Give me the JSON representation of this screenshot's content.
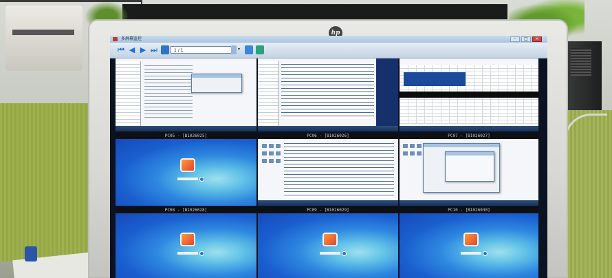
{
  "viewer": {
    "title": "多屏幕监控",
    "page_field": "1 / 1",
    "window_buttons": {
      "minimize": "–",
      "maximize": "□",
      "close": "×"
    }
  },
  "monitor": {
    "brand": "hp"
  },
  "icons": {
    "first": "first-page-icon",
    "prev": "prev-page-icon",
    "next": "next-page-icon",
    "last": "last-page-icon",
    "home": "home-icon",
    "view": "view-icon",
    "network": "network-icon",
    "tools": "tools-icon"
  },
  "cells": [
    {
      "label": "",
      "kind": "desktop-doc"
    },
    {
      "label": "",
      "kind": "desktop-code"
    },
    {
      "label": "",
      "kind": "desktop-sheet"
    },
    {
      "label": "PC05 - [B1026025]",
      "kind": "login"
    },
    {
      "label": "PC06 - [B1026026]",
      "kind": "desktop-dev"
    },
    {
      "label": "PC07 - [B1026027]",
      "kind": "desktop-dialog"
    },
    {
      "label": "PC08 - [B1026028]",
      "kind": "login"
    },
    {
      "label": "PC09 - [B1026029]",
      "kind": "login"
    },
    {
      "label": "PC10 - [B1026030]",
      "kind": "login"
    }
  ]
}
